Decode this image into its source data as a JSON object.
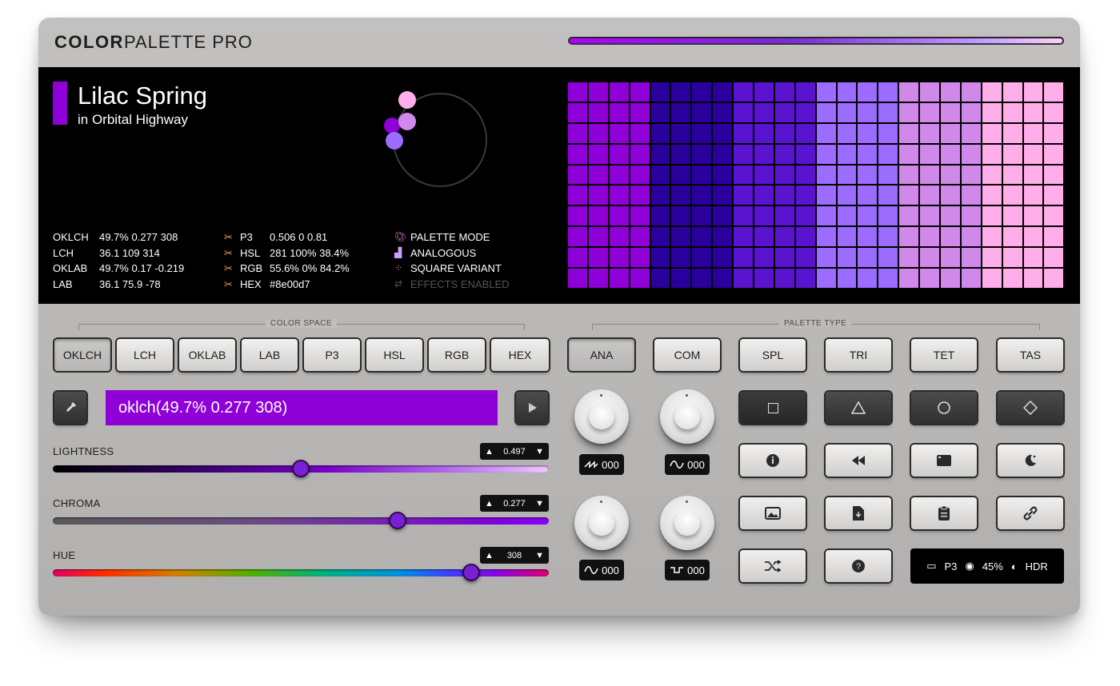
{
  "app": {
    "title_bold": "COLOR",
    "title_rest": "PALETTE PRO"
  },
  "palette": {
    "name": "Lilac Spring",
    "subtitle": "in Orbital Highway",
    "swatch_color": "#8e00d7"
  },
  "readouts": {
    "spaces": [
      {
        "key": "OKLCH",
        "value": "49.7% 0.277 308"
      },
      {
        "key": "LCH",
        "value": "36.1 109 314"
      },
      {
        "key": "OKLAB",
        "value": "49.7% 0.17 -0.219"
      },
      {
        "key": "LAB",
        "value": "36.1 75.9 -78"
      }
    ],
    "formats": [
      {
        "icon": "scissors-icon",
        "key": "P3",
        "value": "0.506 0 0.81"
      },
      {
        "icon": "scissors-icon",
        "key": "HSL",
        "value": "281 100% 38.4%"
      },
      {
        "icon": "scissors-icon",
        "key": "RGB",
        "value": "55.6% 0% 84.2%"
      },
      {
        "icon": "scissors-icon",
        "key": "HEX",
        "value": "#8e00d7"
      }
    ],
    "modes": [
      {
        "icon": "palette-icon",
        "label": "PALETTE MODE"
      },
      {
        "icon": "paint-bucket-icon",
        "label": "ANALOGOUS"
      },
      {
        "icon": "four-dots-icon",
        "label": "SQUARE VARIANT"
      },
      {
        "icon": "arrows-swap-icon",
        "label": "EFFECTS ENABLED"
      }
    ]
  },
  "grid_colors": [
    "#8e00d7",
    "#2a009c",
    "#5a14cf",
    "#9c6bff",
    "#d088ea",
    "#ffaeea"
  ],
  "color_space": {
    "label": "COLOR SPACE",
    "buttons": [
      "OKLCH",
      "LCH",
      "OKLAB",
      "LAB",
      "P3",
      "HSL",
      "RGB",
      "HEX"
    ],
    "active": "OKLCH"
  },
  "palette_type": {
    "label": "PALETTE TYPE",
    "buttons": [
      "ANA",
      "COM",
      "SPL",
      "TRI",
      "TET",
      "TAS"
    ],
    "active": "ANA"
  },
  "color_input": {
    "value": "oklch(49.7% 0.277 308)"
  },
  "sliders": {
    "lightness": {
      "label": "LIGHTNESS",
      "value": "0.497",
      "fraction": 0.5
    },
    "chroma": {
      "label": "CHROMA",
      "value": "0.277",
      "fraction": 0.695
    },
    "hue": {
      "label": "HUE",
      "value": "308",
      "fraction": 0.844
    }
  },
  "lfos": [
    {
      "wave": "sawtooth-wave-icon",
      "value": "000"
    },
    {
      "wave": "sine-wave-icon",
      "value": "000"
    },
    {
      "wave": "sine-wave-icon",
      "value": "000"
    },
    {
      "wave": "square-wave-icon",
      "value": "000"
    }
  ],
  "status": {
    "gamut": "P3",
    "vision": "45%",
    "mode": "HDR"
  }
}
